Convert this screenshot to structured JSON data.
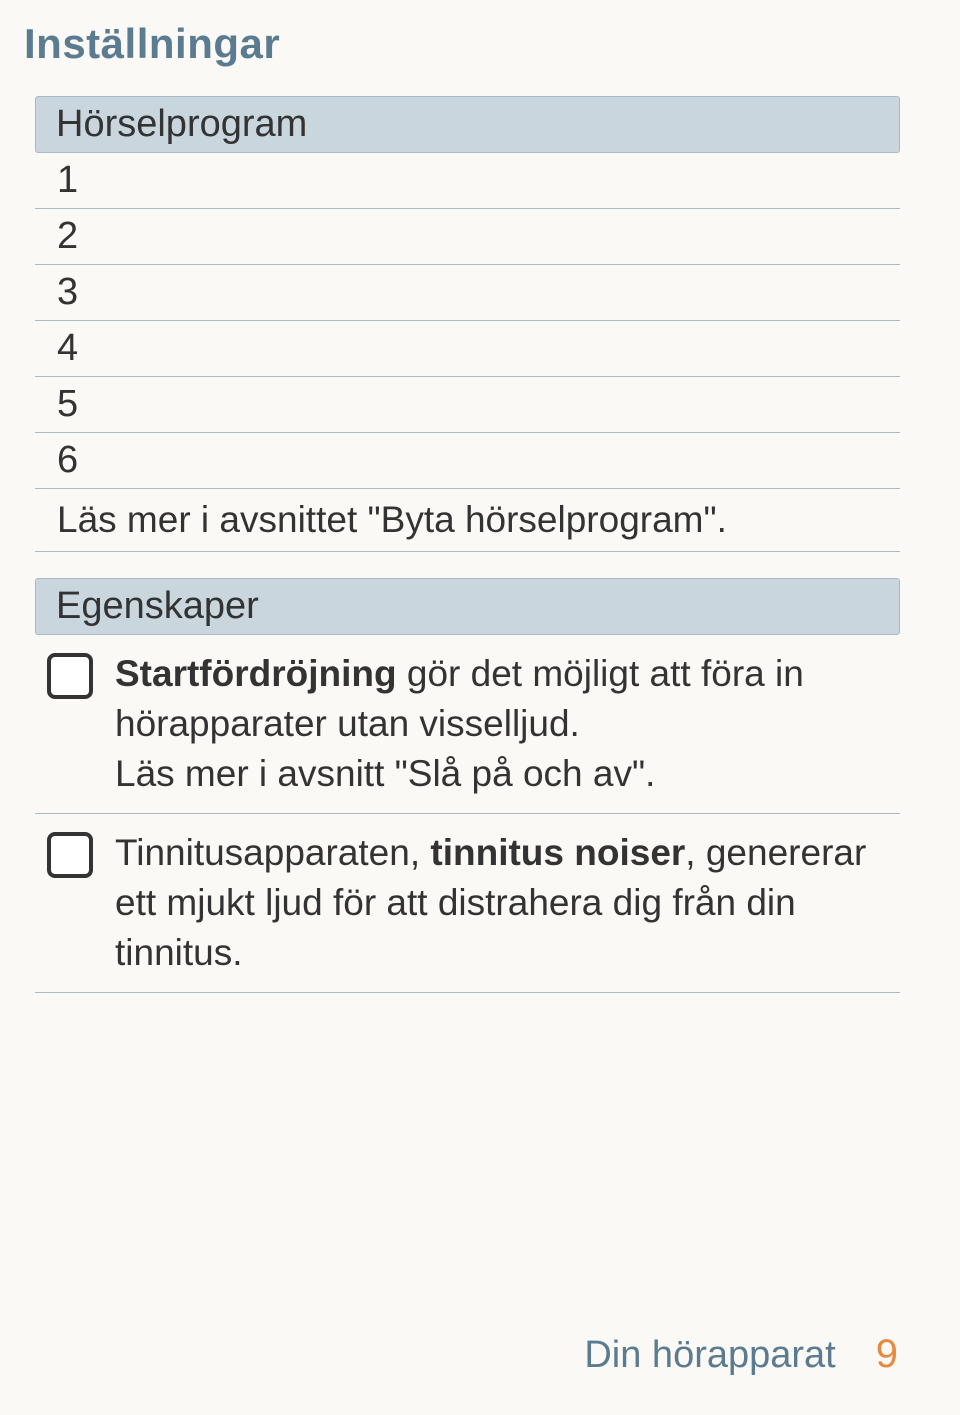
{
  "title": "Inställningar",
  "sections": {
    "programs": {
      "header": "Hörselprogram",
      "items": [
        "1",
        "2",
        "3",
        "4",
        "5",
        "6"
      ],
      "caption": "Läs mer i avsnittet \"Byta hörselprogram\"."
    },
    "features": {
      "header": "Egenskaper",
      "items": [
        {
          "bold_lead": "Startfördröjning",
          "rest": " gör det möjligt att föra in hörapparater utan visselljud.\nLäs mer i avsnitt \"Slå på och av\"."
        },
        {
          "pre": "Tinnitusapparaten, ",
          "bold_mid": "tinnitus noiser",
          "rest": ", genererar ett mjukt ljud för att distrahera dig från din tinnitus."
        }
      ]
    }
  },
  "footer": {
    "label": "Din hörapparat",
    "page": "9"
  }
}
